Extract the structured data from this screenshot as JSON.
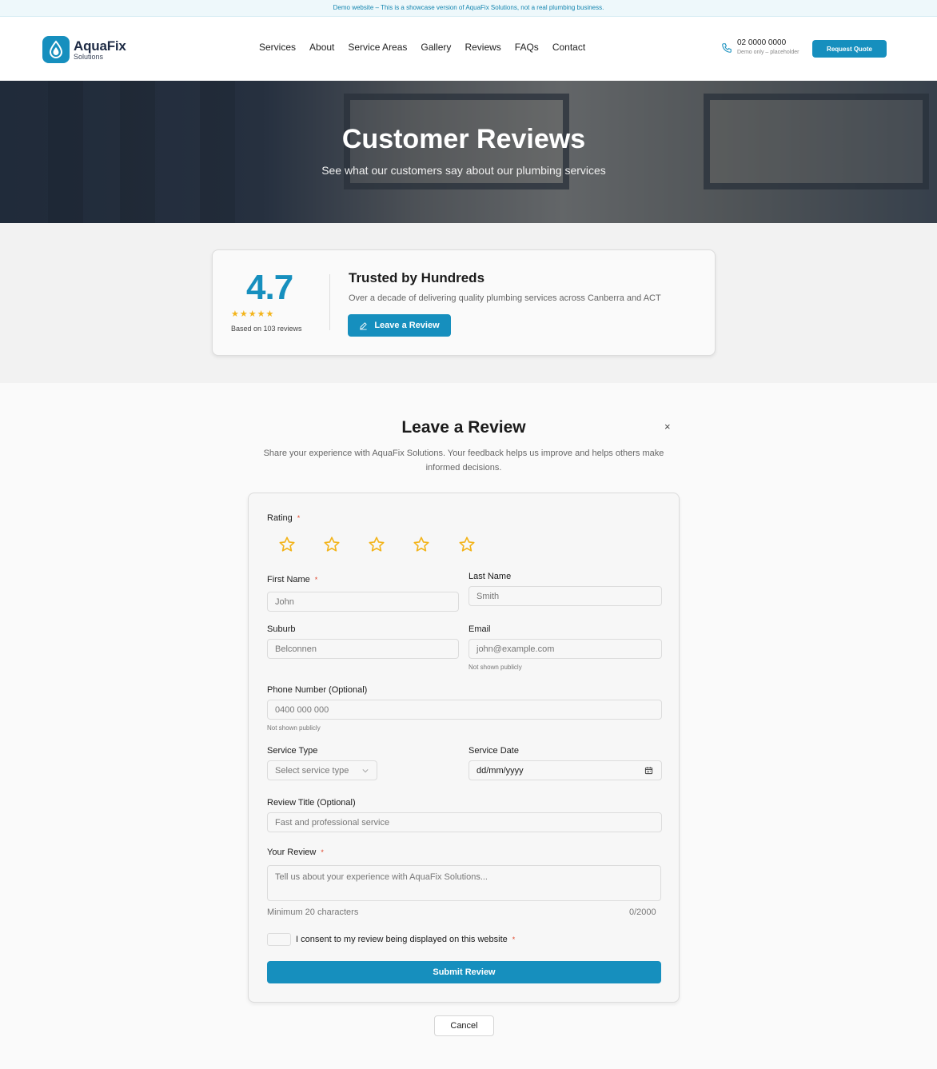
{
  "banner": {
    "text": "Demo website – This is a showcase version of AquaFix Solutions, not a real plumbing business."
  },
  "brand": {
    "name": "AquaFix",
    "tagline": "Solutions",
    "color": "#168fbe",
    "star_color": "#f3b41b"
  },
  "nav": {
    "items": [
      "Services",
      "About",
      "Service Areas",
      "Gallery",
      "Reviews",
      "FAQs",
      "Contact"
    ]
  },
  "contact": {
    "phone": "02 0000 0000",
    "phone_note": "Demo only – placeholder",
    "cta": "Request Quote"
  },
  "hero": {
    "title": "Customer Reviews",
    "subtitle": "See what our customers say about our plumbing services"
  },
  "stats": {
    "rating": "4.7",
    "stars": "★★★★★",
    "based_on": "Based on 103 reviews",
    "title": "Trusted by Hundreds",
    "description": "Over a decade of delivering quality plumbing services across Canberra and ACT",
    "button": "Leave a Review"
  },
  "review_form": {
    "title": "Leave a Review",
    "close": "×",
    "description": "Share your experience with AquaFix Solutions. Your feedback helps us improve and helps others make informed decisions.",
    "rating_label": "Rating",
    "required_mark": "*",
    "first_name": {
      "label": "First Name",
      "placeholder": "John"
    },
    "last_name": {
      "label": "Last Name",
      "placeholder": "Smith"
    },
    "suburb": {
      "label": "Suburb",
      "placeholder": "Belconnen"
    },
    "email": {
      "label": "Email",
      "placeholder": "john@example.com",
      "note": "Not shown publicly"
    },
    "phone": {
      "label": "Phone Number (Optional)",
      "placeholder": "0400 000 000",
      "note": "Not shown publicly"
    },
    "service_type": {
      "label": "Service Type",
      "value": "Select service type"
    },
    "service_date": {
      "label": "Service Date",
      "value": "dd/mm/yyyy"
    },
    "review_title": {
      "label": "Review Title (Optional)",
      "placeholder": "Fast and professional service"
    },
    "review": {
      "label": "Your Review",
      "placeholder": "Tell us about your experience with AquaFix Solutions...",
      "min_note": "Minimum 20 characters",
      "counter": "0/2000"
    },
    "consent": "I consent to my review being displayed on this website",
    "submit": "Submit Review",
    "cancel": "Cancel"
  }
}
